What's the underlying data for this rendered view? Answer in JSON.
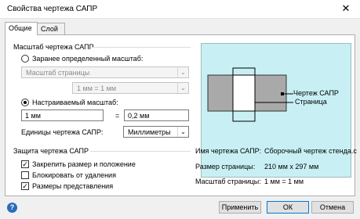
{
  "window": {
    "title": "Свойства чертежа САПР",
    "close": "✕"
  },
  "tabs": [
    "Общие",
    "Слой"
  ],
  "scale": {
    "group_title": "Масштаб чертежа САПР",
    "predefined_label": "Заранее определенный масштаб:",
    "predefined_selected": false,
    "page_scale_value": "Масштаб страницы",
    "ratio_value": "1 мм = 1 мм",
    "custom_label": "Настраиваемый масштаб:",
    "custom_selected": true,
    "custom_left": "1 мм",
    "equals": "=",
    "custom_right": "0,2 мм",
    "units_label": "Единицы чертежа САПР:",
    "units_value": "Миллиметры"
  },
  "protection": {
    "group_title": "Защита чертежа САПР",
    "items": [
      {
        "label": "Закрепить размер и положение",
        "checked": true
      },
      {
        "label": "Блокировать от удаления",
        "checked": false
      },
      {
        "label": "Размеры представления",
        "checked": true
      }
    ]
  },
  "preview": {
    "label_drawing": "Чертеж САПР",
    "label_page": "Страница",
    "bg_color": "#c8f0f4"
  },
  "info": {
    "name_label": "Имя чертежа САПР:",
    "name_value": "Сборочный чертеж стенда.c",
    "size_label": "Размер страницы:",
    "size_value": "210 мм x 297 мм",
    "scale_label": "Масштаб страницы:",
    "scale_value": "1 мм = 1 мм"
  },
  "buttons": {
    "apply": "Применить",
    "ok": "ОК",
    "cancel": "Отмена",
    "help": "?"
  }
}
